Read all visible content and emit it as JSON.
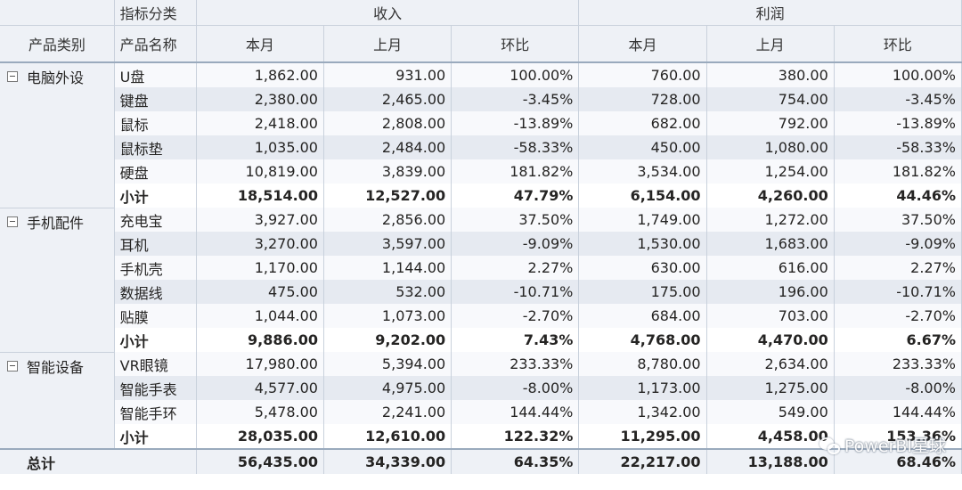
{
  "header": {
    "row1_label": "指标分类",
    "group_income": "收入",
    "group_profit": "利润",
    "col_category": "产品类别",
    "col_name": "产品名称",
    "col_cur": "本月",
    "col_prev": "上月",
    "col_mom": "环比"
  },
  "groups": [
    {
      "category": "电脑外设",
      "rows": [
        {
          "name": "U盘",
          "inc_cur": "1,862.00",
          "inc_prev": "931.00",
          "inc_mom": "100.00%",
          "pro_cur": "760.00",
          "pro_prev": "380.00",
          "pro_mom": "100.00%"
        },
        {
          "name": "键盘",
          "inc_cur": "2,380.00",
          "inc_prev": "2,465.00",
          "inc_mom": "-3.45%",
          "pro_cur": "728.00",
          "pro_prev": "754.00",
          "pro_mom": "-3.45%"
        },
        {
          "name": "鼠标",
          "inc_cur": "2,418.00",
          "inc_prev": "2,808.00",
          "inc_mom": "-13.89%",
          "pro_cur": "682.00",
          "pro_prev": "792.00",
          "pro_mom": "-13.89%"
        },
        {
          "name": "鼠标垫",
          "inc_cur": "1,035.00",
          "inc_prev": "2,484.00",
          "inc_mom": "-58.33%",
          "pro_cur": "450.00",
          "pro_prev": "1,080.00",
          "pro_mom": "-58.33%"
        },
        {
          "name": "硬盘",
          "inc_cur": "10,819.00",
          "inc_prev": "3,839.00",
          "inc_mom": "181.82%",
          "pro_cur": "3,534.00",
          "pro_prev": "1,254.00",
          "pro_mom": "181.82%"
        }
      ],
      "subtotal": {
        "name": "小计",
        "inc_cur": "18,514.00",
        "inc_prev": "12,527.00",
        "inc_mom": "47.79%",
        "pro_cur": "6,154.00",
        "pro_prev": "4,260.00",
        "pro_mom": "44.46%"
      }
    },
    {
      "category": "手机配件",
      "rows": [
        {
          "name": "充电宝",
          "inc_cur": "3,927.00",
          "inc_prev": "2,856.00",
          "inc_mom": "37.50%",
          "pro_cur": "1,749.00",
          "pro_prev": "1,272.00",
          "pro_mom": "37.50%"
        },
        {
          "name": "耳机",
          "inc_cur": "3,270.00",
          "inc_prev": "3,597.00",
          "inc_mom": "-9.09%",
          "pro_cur": "1,530.00",
          "pro_prev": "1,683.00",
          "pro_mom": "-9.09%"
        },
        {
          "name": "手机壳",
          "inc_cur": "1,170.00",
          "inc_prev": "1,144.00",
          "inc_mom": "2.27%",
          "pro_cur": "630.00",
          "pro_prev": "616.00",
          "pro_mom": "2.27%"
        },
        {
          "name": "数据线",
          "inc_cur": "475.00",
          "inc_prev": "532.00",
          "inc_mom": "-10.71%",
          "pro_cur": "175.00",
          "pro_prev": "196.00",
          "pro_mom": "-10.71%"
        },
        {
          "name": "贴膜",
          "inc_cur": "1,044.00",
          "inc_prev": "1,073.00",
          "inc_mom": "-2.70%",
          "pro_cur": "684.00",
          "pro_prev": "703.00",
          "pro_mom": "-2.70%"
        }
      ],
      "subtotal": {
        "name": "小计",
        "inc_cur": "9,886.00",
        "inc_prev": "9,202.00",
        "inc_mom": "7.43%",
        "pro_cur": "4,768.00",
        "pro_prev": "4,470.00",
        "pro_mom": "6.67%"
      }
    },
    {
      "category": "智能设备",
      "rows": [
        {
          "name": "VR眼镜",
          "inc_cur": "17,980.00",
          "inc_prev": "5,394.00",
          "inc_mom": "233.33%",
          "pro_cur": "8,780.00",
          "pro_prev": "2,634.00",
          "pro_mom": "233.33%"
        },
        {
          "name": "智能手表",
          "inc_cur": "4,577.00",
          "inc_prev": "4,975.00",
          "inc_mom": "-8.00%",
          "pro_cur": "1,173.00",
          "pro_prev": "1,275.00",
          "pro_mom": "-8.00%"
        },
        {
          "name": "智能手环",
          "inc_cur": "5,478.00",
          "inc_prev": "2,241.00",
          "inc_mom": "144.44%",
          "pro_cur": "1,342.00",
          "pro_prev": "549.00",
          "pro_mom": "144.44%"
        }
      ],
      "subtotal": {
        "name": "小计",
        "inc_cur": "28,035.00",
        "inc_prev": "12,610.00",
        "inc_mom": "122.32%",
        "pro_cur": "11,295.00",
        "pro_prev": "4,458.00",
        "pro_mom": "153.36%"
      }
    }
  ],
  "total": {
    "label": "总计",
    "inc_cur": "56,435.00",
    "inc_prev": "34,339.00",
    "inc_mom": "64.35%",
    "pro_cur": "22,217.00",
    "pro_prev": "13,188.00",
    "pro_mom": "68.46%"
  },
  "watermark": {
    "text": "PowerBI星球",
    "icon": "wechat-icon"
  },
  "icons": {
    "collapse": "collapse-minus-icon"
  }
}
